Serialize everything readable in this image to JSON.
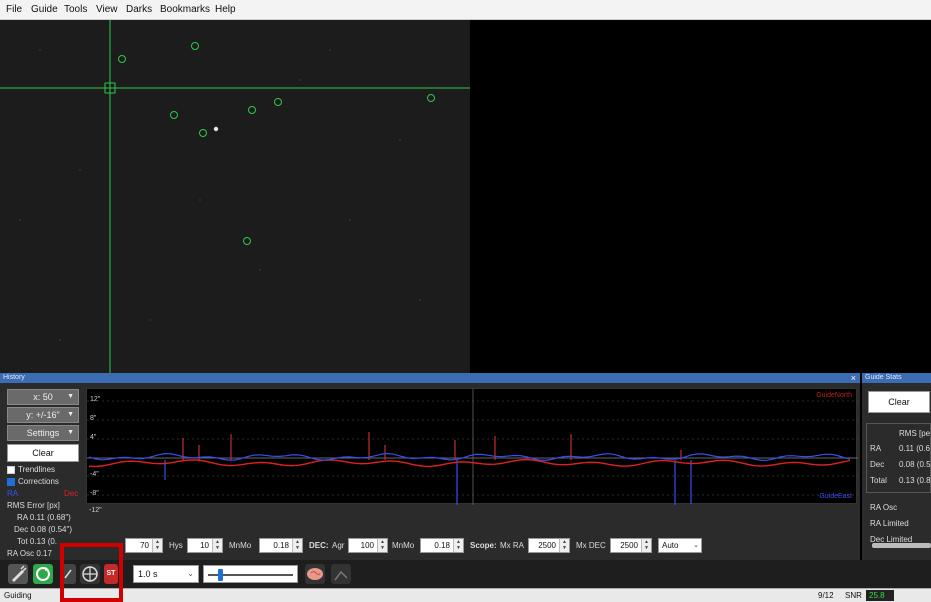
{
  "menu": [
    "File",
    "Guide",
    "Tools",
    "View",
    "Darks",
    "Bookmarks",
    "Help"
  ],
  "history": {
    "title": "History",
    "x_scale": "x: 50",
    "y_scale": "y: +/-16\"",
    "settings": "Settings",
    "clear": "Clear",
    "trendlines": "Trendlines",
    "corrections": "Corrections",
    "trendlines_checked": false,
    "corrections_checked": true,
    "ra_label": "RA",
    "dec_label": "Dec",
    "rms_title": "RMS Error [px]",
    "rms_ra": "RA 0.11 (0.68\")",
    "rms_dec": "Dec 0.08 (0.54\")",
    "rms_tot": "Tot 0.13 (0.",
    "ra_osc": "RA Osc 0.17",
    "close_icon": "×"
  },
  "graph": {
    "y_labels": [
      "12\"",
      "8\"",
      "4\"",
      "-4\"",
      "-8\"",
      "-12\""
    ],
    "guide_north": "GuideNorth",
    "guide_east": "GuideEast",
    "ra_color": "#3a4df0",
    "dec_color": "#e02020"
  },
  "params": {
    "ra_aggr": "70",
    "hys_label": "Hys",
    "hys": "10",
    "mnmo_label": "MnMo",
    "ra_mnmo": "0.18",
    "dec_label": "DEC:",
    "agr_label": "Agr",
    "dec_agr": "100",
    "dec_mnmo_label": "MnMo",
    "dec_mnmo": "0.18",
    "scope_label": "Scope:",
    "mxra_label": "Mx RA",
    "mx_ra": "2500",
    "mxdec_label": "Mx DEC",
    "mx_dec": "2500",
    "mode": "Auto"
  },
  "toolbar": {
    "exposure": "1.0 s"
  },
  "guide_stats": {
    "title": "Guide Stats",
    "clear": "Clear",
    "rms_header": "RMS [pe",
    "ra_label": "RA",
    "ra_value": "0.11 (0.6",
    "dec_label": "Dec",
    "dec_value": "0.08 (0.5",
    "total_label": "Total",
    "total_value": "0.13 (0.8",
    "ra_osc": "RA Osc",
    "ra_limited": "RA Limited",
    "dec_limited": "Dec Limited"
  },
  "status": {
    "state": "Guiding",
    "frame": "9/12",
    "snr_label": "SNR",
    "snr_value": "25.8"
  }
}
